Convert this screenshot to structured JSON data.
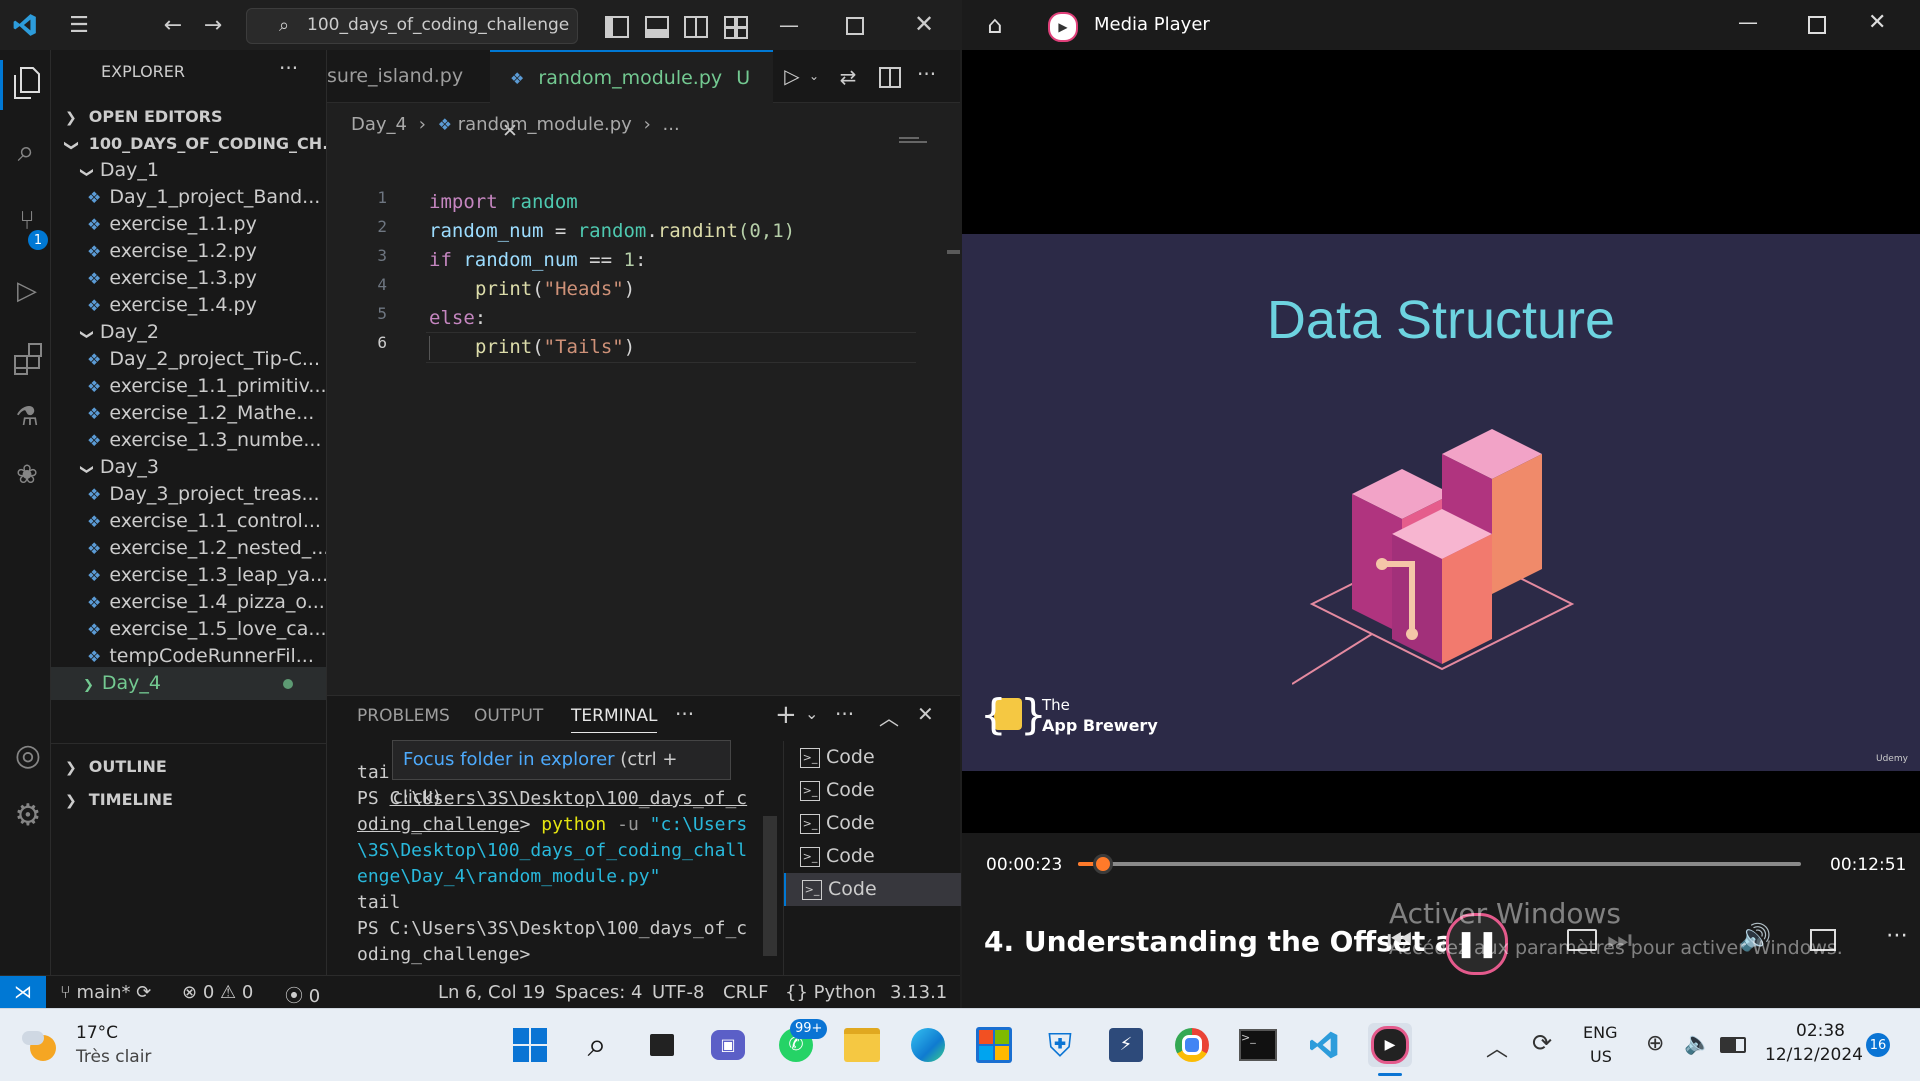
{
  "vscode": {
    "search_text": "100_days_of_coding_challenge",
    "explorer_title": "EXPLORER",
    "open_editors": "OPEN EDITORS",
    "root_folder": "100_DAYS_OF_CODING_CH...",
    "tree": [
      {
        "label": "Day_1",
        "type": "folder"
      },
      {
        "label": "Day_1_project_Band...",
        "type": "file"
      },
      {
        "label": "exercise_1.1.py",
        "type": "file"
      },
      {
        "label": "exercise_1.2.py",
        "type": "file"
      },
      {
        "label": "exercise_1.3.py",
        "type": "file"
      },
      {
        "label": "exercise_1.4.py",
        "type": "file"
      },
      {
        "label": "Day_2",
        "type": "folder"
      },
      {
        "label": "Day_2_project_Tip-C...",
        "type": "file"
      },
      {
        "label": "exercise_1.1_primitiv...",
        "type": "file"
      },
      {
        "label": "exercise_1.2_Mathe...",
        "type": "file"
      },
      {
        "label": "exercise_1.3_numbe...",
        "type": "file"
      },
      {
        "label": "Day_3",
        "type": "folder"
      },
      {
        "label": "Day_3_project_treas...",
        "type": "file"
      },
      {
        "label": "exercise_1.1_control...",
        "type": "file"
      },
      {
        "label": "exercise_1.2_nested_...",
        "type": "file"
      },
      {
        "label": "exercise_1.3_leap_ya...",
        "type": "file"
      },
      {
        "label": "exercise_1.4_pizza_o...",
        "type": "file"
      },
      {
        "label": "exercise_1.5_love_ca...",
        "type": "file"
      },
      {
        "label": "tempCodeRunnerFil...",
        "type": "file"
      },
      {
        "label": "Day_4",
        "type": "folder-collapsed"
      }
    ],
    "outline": "OUTLINE",
    "timeline": "TIMELINE",
    "tab_inactive": "sure_island.py",
    "tab_active": "random_module.py",
    "tab_active_status": "U",
    "breadcrumb_folder": "Day_4",
    "breadcrumb_file": "random_module.py",
    "breadcrumb_more": "...",
    "code_lines": [
      {
        "n": "1"
      },
      {
        "n": "2"
      },
      {
        "n": "3"
      },
      {
        "n": "4"
      },
      {
        "n": "5"
      },
      {
        "n": "6"
      }
    ],
    "code": {
      "l1_kw": "import",
      "l1_mod": "random",
      "l2_var": "random_num",
      "l2_eq": " = ",
      "l2_mod": "random",
      "l2_fn": "randint",
      "l2_args": "(0,1)",
      "l3_kw": "if",
      "l3_var": "random_num",
      "l3_op": " == ",
      "l3_num": "1",
      "l3_colon": ":",
      "l4_fn": "print",
      "l4_str": "\"Heads\"",
      "l5_kw": "else",
      "l5_colon": ":",
      "l6_fn": "print",
      "l6_str": "\"Tails\""
    },
    "panel_tabs": [
      "PROBLEMS",
      "OUTPUT",
      "TERMINAL"
    ],
    "tooltip": "Focus folder in explorer",
    "tooltip_hint": "(ctrl + click)",
    "terminal": {
      "l1": "tai",
      "l2_prefix": "PS ",
      "l2_path": "C:\\Users\\3S\\Desktop\\100_days_of_c",
      "l3_path": "oding_challenge",
      "l3_prompt": "> ",
      "l3_cmd": "python",
      "l3_flag": " -u ",
      "l3_arg": "\"c:\\Users",
      "l4": "\\3S\\Desktop\\100_days_of_coding_chall",
      "l5": "enge\\Day_4\\random_module.py\"",
      "l6": "tail",
      "l7": "PS C:\\Users\\3S\\Desktop\\100_days_of_c",
      "l8": "oding_challenge>"
    },
    "terminals": [
      "Code",
      "Code",
      "Code",
      "Code",
      "Code"
    ],
    "status": {
      "branch": "main*",
      "errors": "0",
      "warnings": "0",
      "ports": "0",
      "position": "Ln 6, Col 19",
      "spaces": "Spaces: 4",
      "encoding": "UTF-8",
      "eol": "CRLF",
      "language": "Python",
      "version": "3.13.1"
    },
    "source_control_badge": "1"
  },
  "media": {
    "title": "Media Player",
    "slide_title": "Data Structure",
    "brand_the": "The",
    "brand_name": "App Brewery",
    "watermark": "Udemy",
    "time_current": "00:00:23",
    "time_total": "00:12:51",
    "progress": 0.035,
    "episode_title": "4. Understanding the Offset an...",
    "activate_title": "Activer Windows",
    "activate_sub": "Accédez aux paramètres pour activer Windows."
  },
  "taskbar": {
    "temp": "17°C",
    "weather": "Très clair",
    "whatsapp_badge": "99+",
    "lang1": "ENG",
    "lang2": "US",
    "time": "02:38",
    "date": "12/12/2024",
    "notif_count": "16"
  },
  "colors": {
    "accent": "#0078d4",
    "slide_bg": "#2c2a47",
    "slide_title": "#6dd3e0",
    "progress": "#ff7a2a"
  }
}
